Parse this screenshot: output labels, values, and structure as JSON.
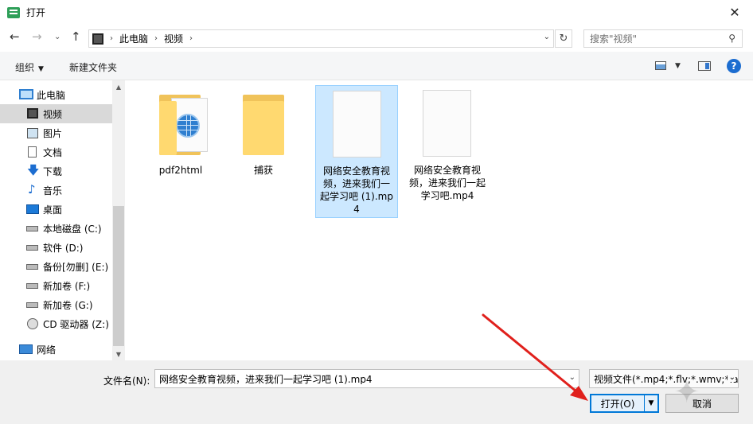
{
  "window": {
    "title": "打开"
  },
  "address": {
    "crumbs": [
      "此电脑",
      "视频"
    ]
  },
  "search": {
    "placeholder": "搜索\"视频\""
  },
  "toolbar": {
    "organize_label": "组织",
    "new_folder_label": "新建文件夹"
  },
  "sidebar": {
    "items": [
      {
        "label": "此电脑",
        "icon": "computer-icon"
      },
      {
        "label": "视频",
        "icon": "video-icon",
        "selected": true
      },
      {
        "label": "图片",
        "icon": "picture-icon"
      },
      {
        "label": "文档",
        "icon": "document-icon"
      },
      {
        "label": "下载",
        "icon": "download-icon"
      },
      {
        "label": "音乐",
        "icon": "music-icon"
      },
      {
        "label": "桌面",
        "icon": "desktop-icon"
      },
      {
        "label": "本地磁盘 (C:)",
        "icon": "windows-drive-icon"
      },
      {
        "label": "软件 (D:)",
        "icon": "drive-icon"
      },
      {
        "label": "备份[勿删] (E:)",
        "icon": "drive-icon"
      },
      {
        "label": "新加卷 (F:)",
        "icon": "drive-icon"
      },
      {
        "label": "新加卷 (G:)",
        "icon": "drive-icon"
      },
      {
        "label": "CD 驱动器 (Z:)",
        "icon": "cd-drive-icon"
      },
      {
        "label": "网络",
        "icon": "network-icon"
      }
    ]
  },
  "files": [
    {
      "name": "pdf2html",
      "type": "folder",
      "icon": "folder-html-icon"
    },
    {
      "name": "捕获",
      "type": "folder",
      "icon": "folder-icon"
    },
    {
      "name": "网络安全教育视频，进来我们一起学习吧 (1).mp4",
      "type": "file",
      "icon": "blank-file-icon",
      "selected": true
    },
    {
      "name": "网络安全教育视频，进来我们一起学习吧.mp4",
      "type": "file",
      "icon": "blank-file-icon"
    }
  ],
  "footer": {
    "filename_label": "文件名(N):",
    "filename_value": "网络安全教育视频，进来我们一起学习吧 (1).mp4",
    "filter_value": "视频文件(*.mp4;*.flv;*.wmv;*.a",
    "open_label": "打开(O)",
    "cancel_label": "取消"
  },
  "colors": {
    "selection": "#cce8ff",
    "accent": "#0078d7",
    "annotation_arrow": "#e0201c"
  }
}
